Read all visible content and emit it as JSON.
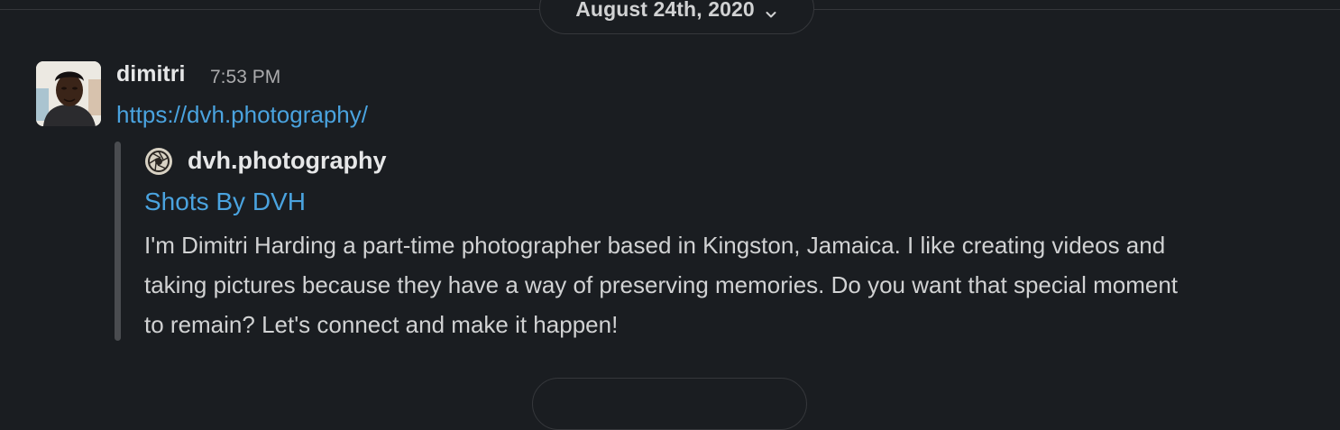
{
  "date_divider": {
    "label": "August 24th, 2020",
    "icon": "chevron-down-icon"
  },
  "message": {
    "sender": "dimitri",
    "time": "7:53 PM",
    "link": "https://dvh.photography/",
    "avatar_icon": "user-avatar"
  },
  "unfurl": {
    "site_icon": "camera-aperture-icon",
    "site_name": "dvh.photography",
    "title": "Shots By DVH",
    "description": "I'm Dimitri Harding a part-time photographer based in Kingston, Jamaica. I like creating videos and taking pictures because they have a way of preserving memories. Do you want that special moment to remain? Let's connect and make it happen!"
  },
  "colors": {
    "background": "#1a1d21",
    "link": "#4aa3df",
    "attachment_bar": "#4a4c50",
    "border": "#35373b"
  }
}
